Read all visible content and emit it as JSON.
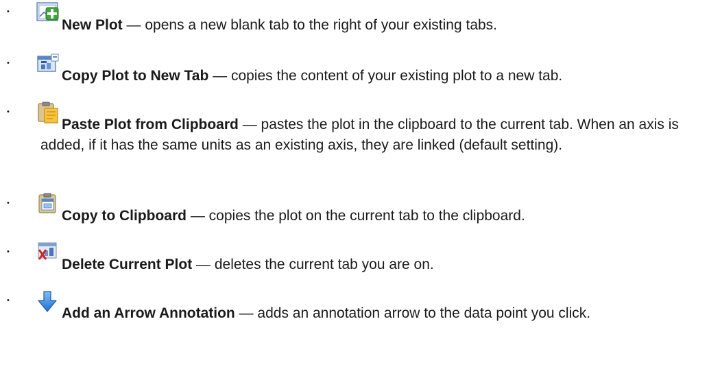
{
  "items": [
    {
      "icon": "new-plot-icon",
      "title": "New Plot",
      "desc": " — opens a new blank tab to the right of your existing tabs."
    },
    {
      "icon": "copy-plot-to-new-tab-icon",
      "title": "Copy Plot to New Tab",
      "desc": " — copies the content of your existing plot to a new tab."
    },
    {
      "icon": "paste-plot-icon",
      "title": "Paste Plot from Clipboard",
      "desc": " — pastes the plot in the clipboard to the current tab. When an axis is added, if it has the same units as an existing axis, they are linked (default setting)."
    },
    {
      "icon": "copy-to-clipboard-icon",
      "title": "Copy to Clipboard",
      "desc": " — copies the plot on the current tab to the clipboard."
    },
    {
      "icon": "delete-plot-icon",
      "title": "Delete Current Plot",
      "desc": " — deletes the current tab you are on."
    },
    {
      "icon": "arrow-annotation-icon",
      "title": "Add an Arrow Annotation",
      "desc": " — adds an annotation arrow to the data point you click."
    }
  ],
  "bullet": "•"
}
